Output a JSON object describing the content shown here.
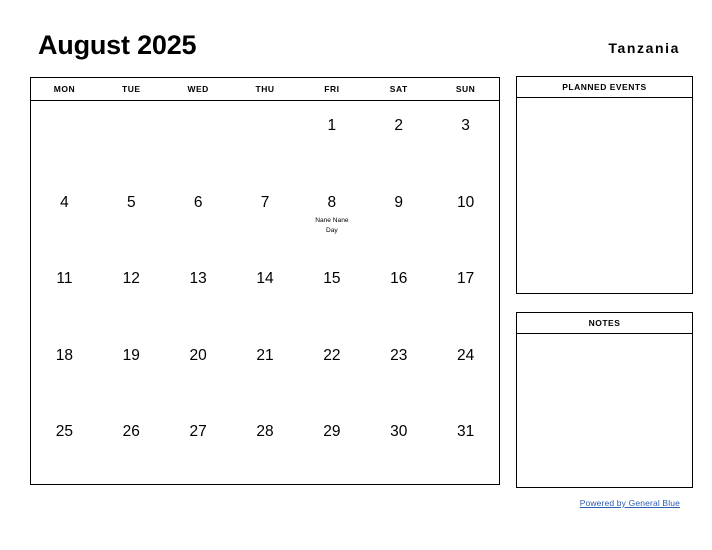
{
  "header": {
    "title": "August 2025",
    "country": "Tanzania"
  },
  "calendar": {
    "month": "August",
    "year": "2025",
    "weekday_headers": [
      "MON",
      "TUE",
      "WED",
      "THU",
      "FRI",
      "SAT",
      "SUN"
    ],
    "weeks": [
      [
        {
          "day": "",
          "events": []
        },
        {
          "day": "",
          "events": []
        },
        {
          "day": "",
          "events": []
        },
        {
          "day": "",
          "events": []
        },
        {
          "day": "1",
          "events": []
        },
        {
          "day": "2",
          "events": []
        },
        {
          "day": "3",
          "events": []
        }
      ],
      [
        {
          "day": "4",
          "events": []
        },
        {
          "day": "5",
          "events": []
        },
        {
          "day": "6",
          "events": []
        },
        {
          "day": "7",
          "events": []
        },
        {
          "day": "8",
          "events": [
            "Nane Nane",
            "Day"
          ]
        },
        {
          "day": "9",
          "events": []
        },
        {
          "day": "10",
          "events": []
        }
      ],
      [
        {
          "day": "11",
          "events": []
        },
        {
          "day": "12",
          "events": []
        },
        {
          "day": "13",
          "events": []
        },
        {
          "day": "14",
          "events": []
        },
        {
          "day": "15",
          "events": []
        },
        {
          "day": "16",
          "events": []
        },
        {
          "day": "17",
          "events": []
        }
      ],
      [
        {
          "day": "18",
          "events": []
        },
        {
          "day": "19",
          "events": []
        },
        {
          "day": "20",
          "events": []
        },
        {
          "day": "21",
          "events": []
        },
        {
          "day": "22",
          "events": []
        },
        {
          "day": "23",
          "events": []
        },
        {
          "day": "24",
          "events": []
        }
      ],
      [
        {
          "day": "25",
          "events": []
        },
        {
          "day": "26",
          "events": []
        },
        {
          "day": "27",
          "events": []
        },
        {
          "day": "28",
          "events": []
        },
        {
          "day": "29",
          "events": []
        },
        {
          "day": "30",
          "events": []
        },
        {
          "day": "31",
          "events": []
        }
      ]
    ]
  },
  "panels": [
    {
      "id": "planned-events",
      "title": "PLANNED EVENTS",
      "body": ""
    },
    {
      "id": "notes",
      "title": "NOTES",
      "body": ""
    }
  ],
  "footer": {
    "link_text": "Powered by General Blue",
    "link_color": "#2a5db0"
  }
}
